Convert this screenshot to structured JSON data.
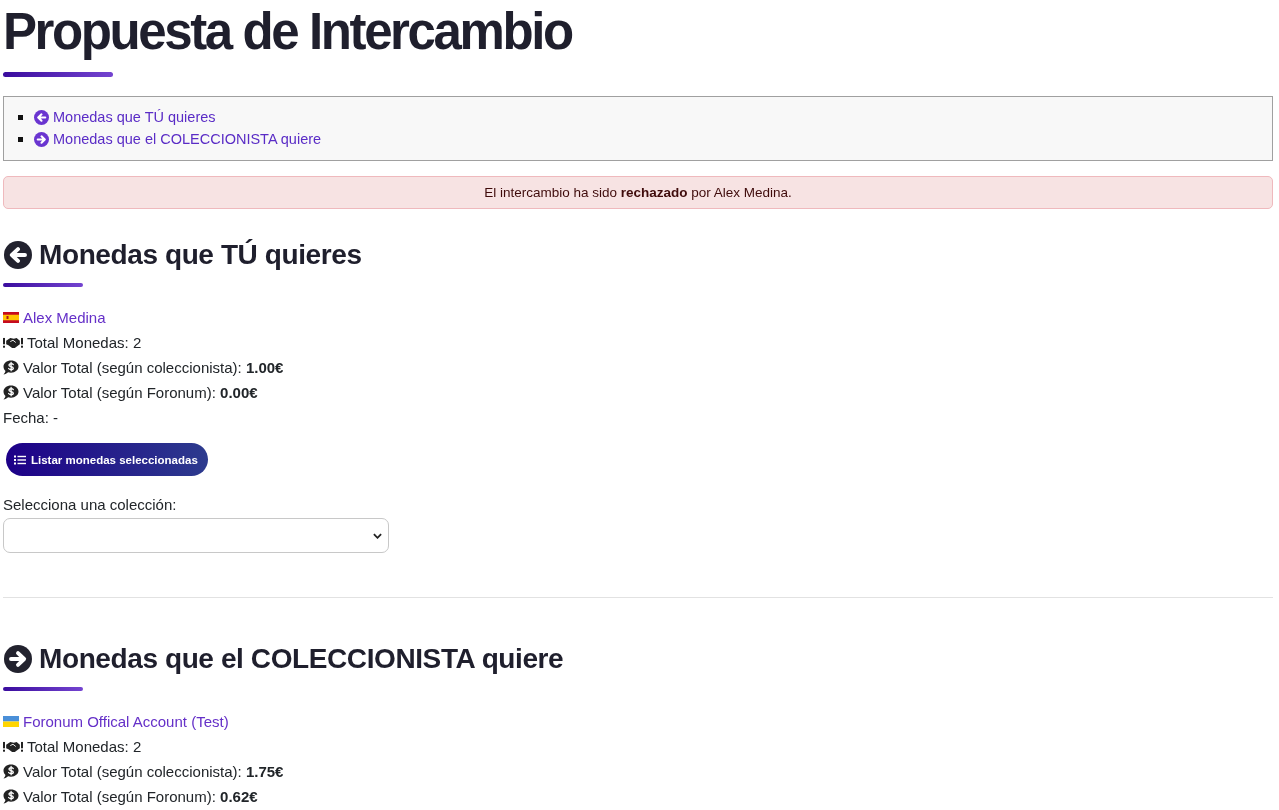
{
  "title": "Propuesta de Intercambio",
  "toc": [
    {
      "label": "Monedas que TÚ quieres",
      "kind": "back"
    },
    {
      "label": "Monedas que el COLECCIONISTA quiere",
      "kind": "forward"
    }
  ],
  "alert": {
    "text": "El intercambio ha sido **rechazado** por Alex Medina."
  },
  "sections": [
    {
      "kind": "back",
      "heading": "Monedas que TÚ quieres",
      "user": {
        "name": "Alex Medina",
        "kind": "spain"
      },
      "lines": [
        {
          "kind": "coins",
          "text": "Total Monedas: 2"
        },
        {
          "kind": "value",
          "text": "Valor Total (según coleccionista): **1.00€**"
        },
        {
          "kind": "value",
          "text": "Valor Total (según Foronum): **0.00€**"
        },
        {
          "kind": "date",
          "text": "Fecha: -"
        }
      ],
      "button": {
        "label": "Listar monedas seleccionadas"
      },
      "collection_select": {
        "label": "Selecciona una colección:"
      }
    },
    {
      "kind": "forward",
      "heading": "Monedas que el COLECCIONISTA quiere",
      "user": {
        "name": "Foronum Offical Account (Test)",
        "kind": "ukraine"
      },
      "lines": [
        {
          "kind": "coins",
          "text": "Total Monedas: 2"
        },
        {
          "kind": "value",
          "text": "Valor Total (según coleccionista): **1.75€**"
        },
        {
          "kind": "value",
          "text": "Valor Total (según Foronum): **0.62€**"
        }
      ]
    }
  ]
}
